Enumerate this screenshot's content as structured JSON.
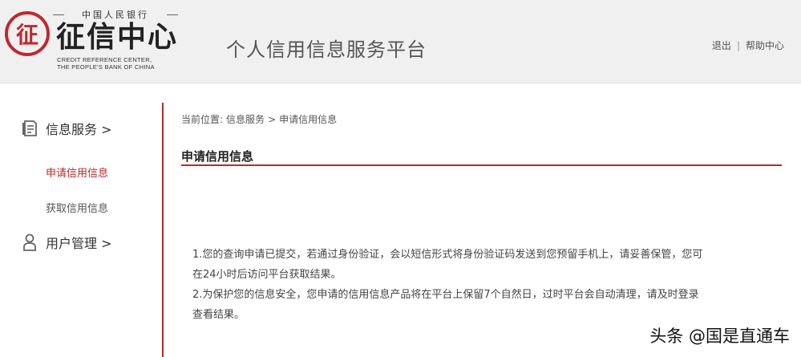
{
  "header": {
    "logo_top": "中国人民银行",
    "logo_main": "征信中心",
    "logo_en_line1": "CREDIT REFERENCE CENTER,",
    "logo_en_line2": "THE PEOPLE'S BANK OF CHINA",
    "platform_title": "个人信用信息服务平台",
    "links": {
      "logout": "退出",
      "separator": "|",
      "help": "帮助中心"
    }
  },
  "sidebar": {
    "sections": [
      {
        "label": "信息服务 >",
        "icon": "document-icon",
        "items": [
          {
            "label": "申请信用信息",
            "active": true
          },
          {
            "label": "获取信用信息",
            "active": false
          }
        ]
      },
      {
        "label": "用户管理 >",
        "icon": "user-icon",
        "items": []
      }
    ]
  },
  "breadcrumb": {
    "prefix": "当前位置:",
    "level1": "信息服务",
    "sep": ">",
    "level2": "申请信用信息"
  },
  "main": {
    "title": "申请信用信息",
    "notice": [
      "1.您的查询申请已提交，若通过身份验证，会以短信形式将身份验证码发送到您预留手机上，请妥善保管，您可在24小时后访问平台获取结果。",
      "2.为保护您的信息安全，您申请的信用信息产品将在平台上保留7个自然日，过时平台会自动清理，请及时登录查看结果。"
    ]
  },
  "watermark": "头条 @国是直通车",
  "colors": {
    "accent": "#b52a2a",
    "logo_red": "#c0282c",
    "header_bg": "#f0f0f0"
  }
}
